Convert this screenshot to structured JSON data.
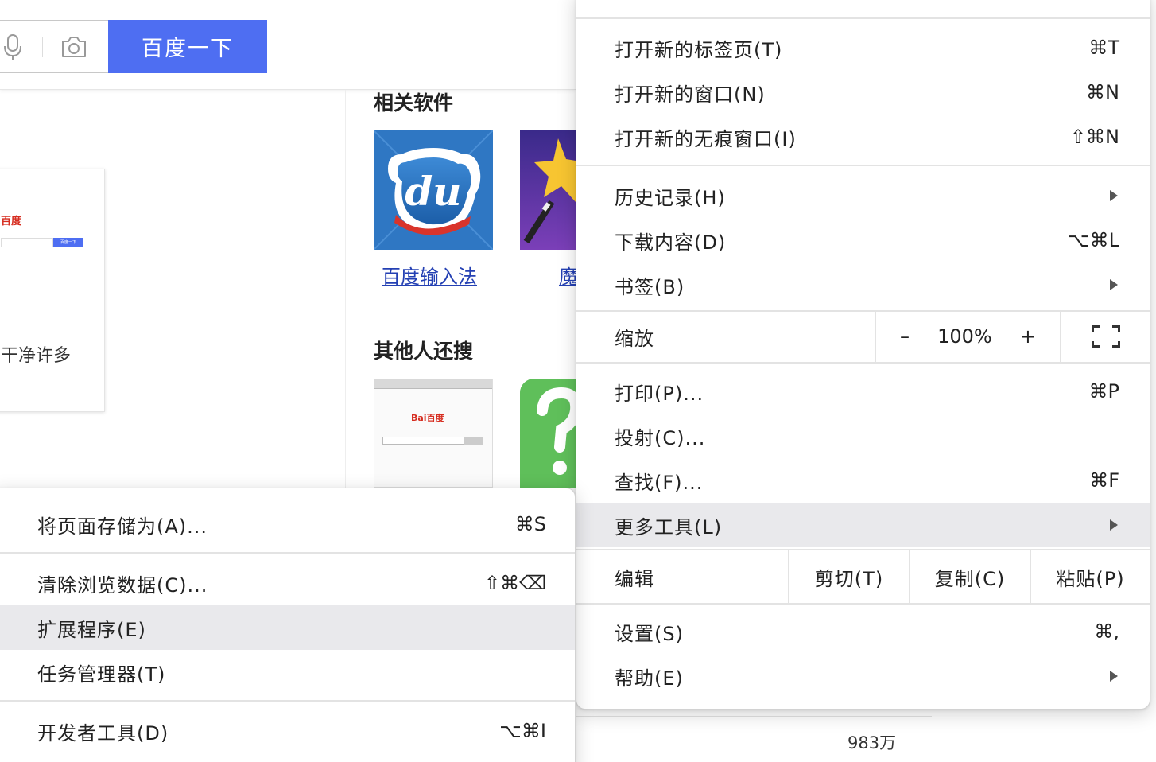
{
  "search": {
    "button_label": "百度一下"
  },
  "preview": {
    "logo_text": "百度",
    "mini_button": "百度一下",
    "caption": "干净许多"
  },
  "related": {
    "title": "相关软件",
    "apps": [
      {
        "icon_text": "du",
        "label": "百度输入法"
      },
      {
        "icon_text": "",
        "label": "魔"
      }
    ]
  },
  "others": {
    "title": "其他人还搜",
    "shot_logo": "Bai百度"
  },
  "bottom": {
    "count": "983万"
  },
  "main_menu": {
    "group1": [
      {
        "label": "打开新的标签页(T)",
        "shortcut": "⌘T"
      },
      {
        "label": "打开新的窗口(N)",
        "shortcut": "⌘N"
      },
      {
        "label": "打开新的无痕窗口(I)",
        "shortcut": "⇧⌘N"
      }
    ],
    "group2": [
      {
        "label": "历史记录(H)",
        "shortcut": ""
      },
      {
        "label": "下载内容(D)",
        "shortcut": "⌥⌘L"
      },
      {
        "label": "书签(B)",
        "shortcut": ""
      }
    ],
    "zoom": {
      "label": "缩放",
      "minus": "–",
      "value": "100%",
      "plus": "+"
    },
    "group3": [
      {
        "label": "打印(P)...",
        "shortcut": "⌘P"
      },
      {
        "label": "投射(C)...",
        "shortcut": ""
      },
      {
        "label": "查找(F)...",
        "shortcut": "⌘F"
      },
      {
        "label": "更多工具(L)",
        "shortcut": ""
      }
    ],
    "edit": {
      "label": "编辑",
      "cut": "剪切(T)",
      "copy": "复制(C)",
      "paste": "粘贴(P)"
    },
    "group4": [
      {
        "label": "设置(S)",
        "shortcut": "⌘,"
      },
      {
        "label": "帮助(E)",
        "shortcut": ""
      }
    ]
  },
  "sub_menu": {
    "items": [
      {
        "label": "将页面存储为(A)...",
        "shortcut": "⌘S"
      },
      {
        "label": "清除浏览数据(C)...",
        "shortcut": "⇧⌘⌫"
      },
      {
        "label": "扩展程序(E)",
        "shortcut": ""
      },
      {
        "label": "任务管理器(T)",
        "shortcut": ""
      },
      {
        "label": "开发者工具(D)",
        "shortcut": "⌥⌘I"
      }
    ]
  },
  "colors": {
    "accent": "#4e6ef2",
    "link": "#2440b3",
    "highlight": "#e9e9ec"
  }
}
